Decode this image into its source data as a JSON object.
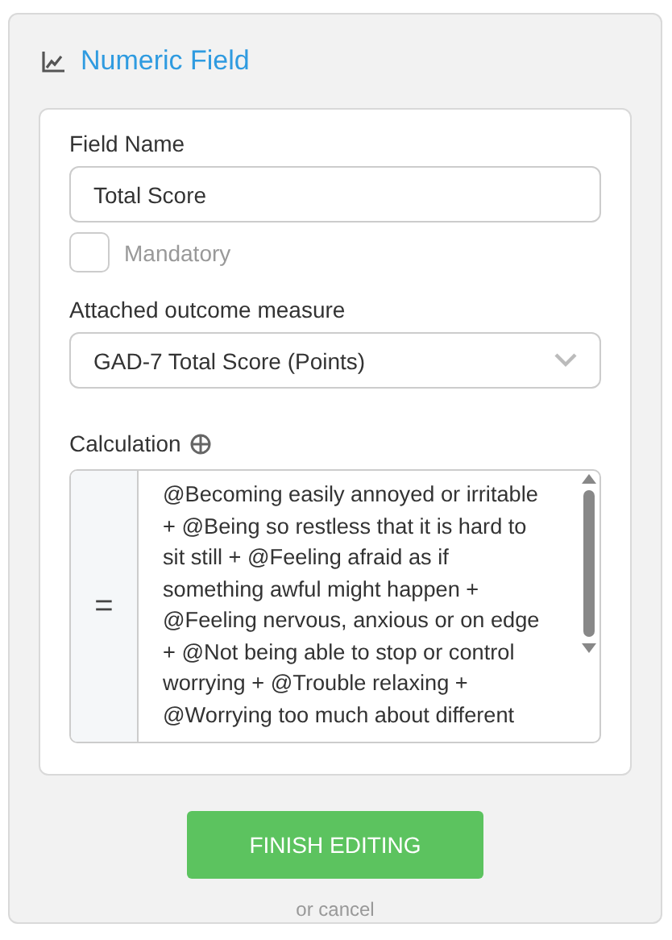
{
  "panel": {
    "title": "Numeric Field"
  },
  "field_name": {
    "label": "Field Name",
    "value": "Total Score"
  },
  "mandatory": {
    "label": "Mandatory",
    "checked": false
  },
  "outcome_measure": {
    "label": "Attached outcome measure",
    "value": "GAD-7 Total Score (Points)"
  },
  "calculation": {
    "label": "Calculation",
    "prefix": "=",
    "value": "@Becoming easily annoyed or irritable + @Being so restless that it is hard to sit still + @Feeling afraid as if something awful might happen + @Feeling nervous, anxious or on edge + @Not being able to stop or control worrying + @Trouble relaxing + @Worrying too much about different"
  },
  "finish_button": "FINISH EDITING",
  "cancel_link": "or cancel"
}
